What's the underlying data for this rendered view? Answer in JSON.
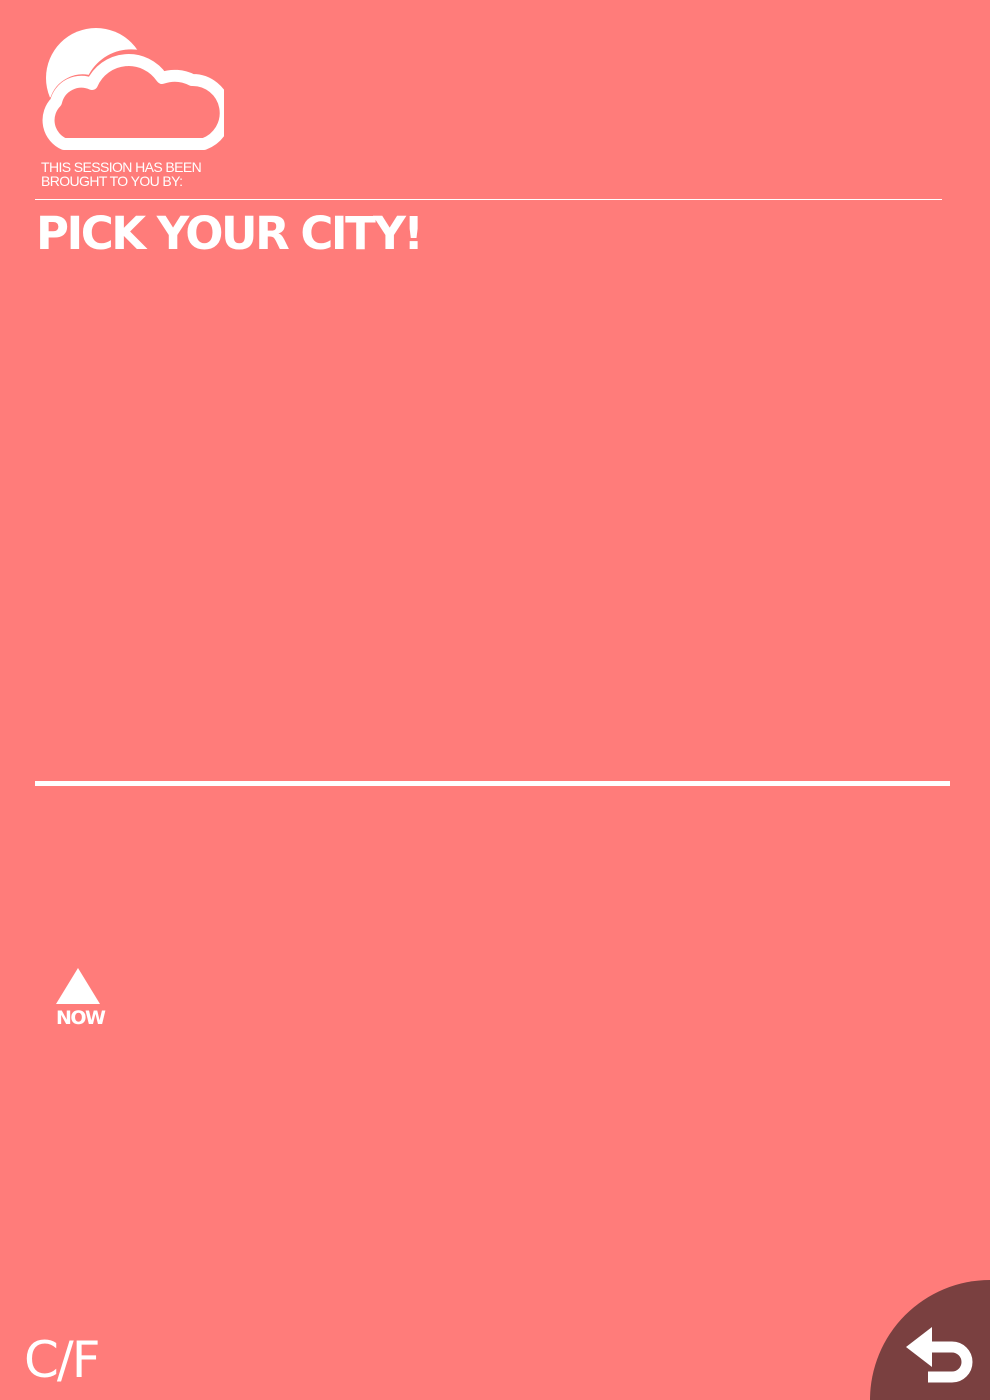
{
  "brand": {
    "logo_icon": "cloud-sun-icon"
  },
  "sponsor": {
    "line1": "THIS SESSION HAS BEEN",
    "line2": "BROUGHT TO YOU BY:"
  },
  "header": {
    "title": "PICK YOUR CITY!"
  },
  "now_button": {
    "label": "NOW",
    "icon": "triangle-up-icon"
  },
  "unit_toggle": {
    "label": "C/F"
  },
  "back_button": {
    "icon": "back-arrow-icon"
  },
  "colors": {
    "background": "#ff7c7a",
    "foreground": "#ffffff",
    "back_button_bg": "#7a4040"
  }
}
